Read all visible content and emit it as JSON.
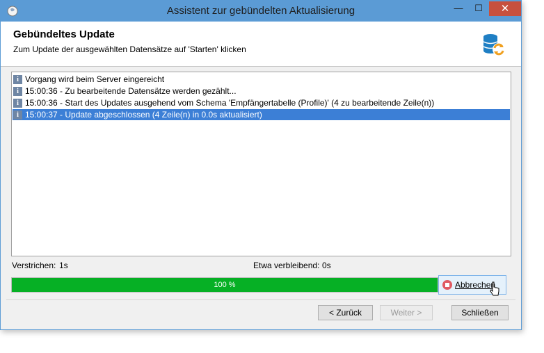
{
  "window": {
    "title": "Assistent zur gebündelten Aktualisierung",
    "minimize_glyph": "—",
    "maximize_glyph": "☐",
    "close_glyph": "✕"
  },
  "header": {
    "title": "Gebündeltes Update",
    "subtitle": "Zum Update der ausgewählten Datensätze auf 'Starten' klicken",
    "icon": "database-refresh-icon"
  },
  "log": {
    "icon": "info-icon",
    "icon_glyph": "i",
    "entries": [
      {
        "text": "Vorgang wird beim Server eingereicht",
        "selected": false
      },
      {
        "text": "15:00:36 - Zu bearbeitende Datensätze werden gezählt...",
        "selected": false
      },
      {
        "text": "15:00:36 - Start des Updates ausgehend vom Schema 'Empfängertabelle (Profile)' (4 zu bearbeitende Zeile(n))",
        "selected": false
      },
      {
        "text": "15:00:37 - Update abgeschlossen (4 Zeile(n) in 0.0s aktualisiert)",
        "selected": true
      }
    ]
  },
  "status": {
    "elapsed_label": "Verstrichen:",
    "elapsed_value": "1s",
    "remaining_label": "Etwa verbleibend:",
    "remaining_value": "0s"
  },
  "progress": {
    "percent": 100,
    "text": "100 %",
    "color": "#06b025"
  },
  "buttons": {
    "abort": "Abbrechen",
    "back": "< Zurück",
    "next": "Weiter >",
    "close": "Schließen"
  },
  "colors": {
    "titlebar": "#5b9bd5",
    "close_button": "#c7503e",
    "selection": "#3c7fd6"
  }
}
